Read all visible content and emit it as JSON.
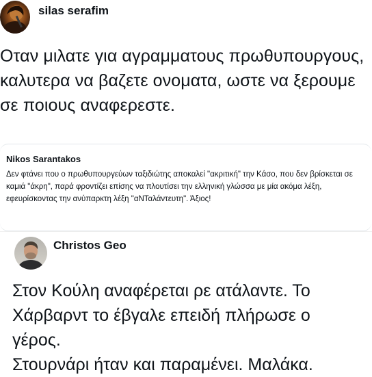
{
  "post": {
    "author": "silas serafim",
    "text": "Οταν μιλατε για αγραμματους πρωθυπουργους, καλυτερα να βαζετε ονοματα, ωστε να ξερουμε σε ποιους αναφερεστε."
  },
  "quoted_post": {
    "author": "Nikos Sarantakos",
    "text": "Δεν φτάνει που ο πρωθυπουργεύων ταξιδιώτης αποκαλεί \"ακριτική\" την Κάσο, που δεν βρίσκεται σε καμιά \"άκρη\", παρά φροντίζει επίσης να πλουτίσει την ελληνική γλώσσα με μία ακόμα λέξη, εφευρίσκοντας την ανύπαρκτη λέξη \"αΝΤαλάντευτη\". Άξιος!"
  },
  "reply": {
    "author": "Christos Geo",
    "line1": "Στον Κούλη αναφέρεται ρε ατάλαντε. Το",
    "line2": "Χάρβαρντ το έβγαλε επειδή πλήρωσε ο",
    "line3": "γέρος.",
    "line4": "Στουρνάρι ήταν και παραμένει. Μαλάκα."
  }
}
